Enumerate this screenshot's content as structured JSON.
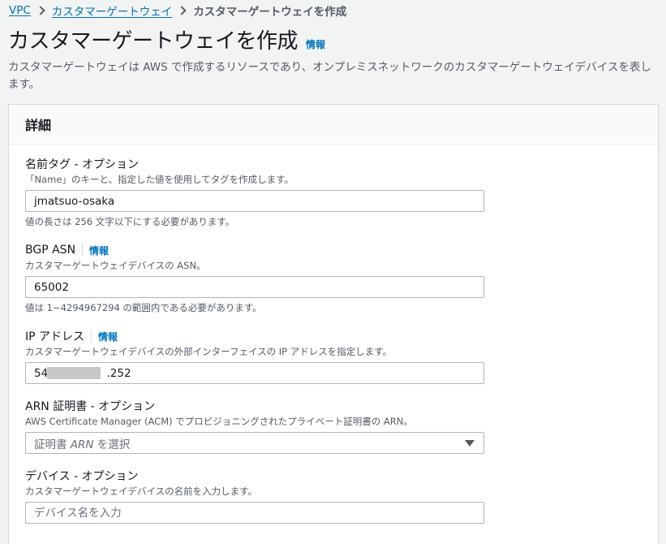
{
  "breadcrumb": {
    "items": [
      "VPC",
      "カスタマーゲートウェイ"
    ],
    "current": "カスタマーゲートウェイを作成"
  },
  "page": {
    "title": "カスタマーゲートウェイを作成",
    "info": "情報",
    "description": "カスタマーゲートウェイは AWS で作成するリソースであり、オンプレミスネットワークのカスタマーゲートウェイデバイスを表します。"
  },
  "panel": {
    "title": "詳細"
  },
  "fields": {
    "name_tag": {
      "label": "名前タグ - オプション",
      "description": "「Name」のキーと、指定した値を使用してタグを作成します。",
      "value": "jmatsuo-osaka",
      "constraint": "値の長さは 256 文字以下にする必要があります。"
    },
    "bgp_asn": {
      "label": "BGP ASN",
      "info": "情報",
      "description": "カスタマーゲートウェイデバイスの ASN。",
      "value": "65002",
      "constraint": "値は 1~4294967294 の範囲内である必要があります。"
    },
    "ip_address": {
      "label": "IP アドレス",
      "info": "情報",
      "description": "カスタマーゲートウェイデバイスの外部インターフェイスの IP アドレスを指定します。",
      "value_prefix": "54.",
      "value_suffix": ".252"
    },
    "arn_cert": {
      "label": "ARN 証明書 - オプション",
      "description": "AWS Certificate Manager (ACM) でプロビジョニングされたプライベート証明書の ARN。",
      "placeholder_prefix": "証明書 ",
      "placeholder_italic": "ARN",
      "placeholder_suffix": " を選択"
    },
    "device": {
      "label": "デバイス - オプション",
      "description": "カスタマーゲートウェイデバイスの名前を入力します。",
      "placeholder": "デバイス名を入力"
    }
  },
  "colors": {
    "link": "#0073bb",
    "background": "#f2f3f3",
    "panel_header": "#fafafa",
    "border": "#aab7b8"
  }
}
